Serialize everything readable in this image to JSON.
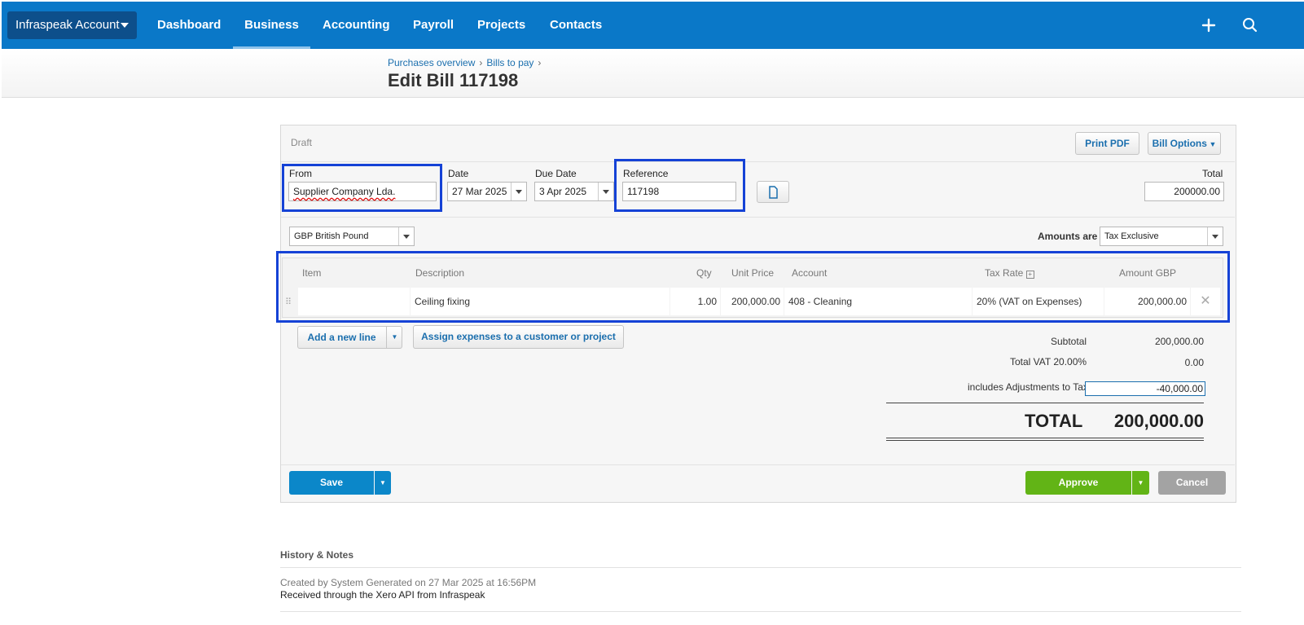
{
  "topbar": {
    "org_label": "Infraspeak Account",
    "nav": [
      "Dashboard",
      "Business",
      "Accounting",
      "Payroll",
      "Projects",
      "Contacts"
    ],
    "active": "Business"
  },
  "breadcrumb": [
    "Purchases overview",
    "Bills to pay"
  ],
  "page_title": "Edit Bill 117198",
  "bill": {
    "status": "Draft",
    "print_pdf": "Print PDF",
    "bill_options": "Bill Options",
    "from_label": "From",
    "from_value": "Supplier Company Lda.",
    "date_label": "Date",
    "date_value": "27 Mar 2025",
    "due_label": "Due Date",
    "due_value": "3 Apr 2025",
    "ref_label": "Reference",
    "ref_value": "117198",
    "total_label": "Total",
    "total_value": "200000.00",
    "currency": "GBP British Pound",
    "amounts_are_label": "Amounts are",
    "amounts_are_value": "Tax Exclusive"
  },
  "table": {
    "headers": [
      "Item",
      "Description",
      "Qty",
      "Unit Price",
      "Account",
      "Tax Rate",
      "Amount GBP"
    ],
    "row": {
      "item": "",
      "description": "Ceiling fixing",
      "qty": "1.00",
      "unit_price": "200,000.00",
      "account": "408 - Cleaning",
      "tax_rate": "20% (VAT on Expenses)",
      "amount": "200,000.00"
    }
  },
  "actions": {
    "add_line": "Add a new line",
    "assign": "Assign expenses to a customer or project",
    "save": "Save",
    "approve": "Approve",
    "cancel": "Cancel"
  },
  "totals": {
    "subtotal_label": "Subtotal",
    "subtotal_value": "200,000.00",
    "vat_label": "Total VAT 20.00%",
    "vat_value": "0.00",
    "adj_label": "includes Adjustments to Tax",
    "adj_value": "-40,000.00",
    "total_label": "TOTAL",
    "total_value": "200,000.00"
  },
  "history": {
    "heading": "History & Notes",
    "created": "Created by System Generated on 27 Mar 2025 at 16:56PM",
    "note": "Received through the Xero API from Infraspeak"
  },
  "colors": {
    "topbar": "#0a78c8",
    "highlight": "#1542d6",
    "save": "#0b87c9",
    "approve": "#62b416",
    "cancel": "#a3a3a3"
  }
}
